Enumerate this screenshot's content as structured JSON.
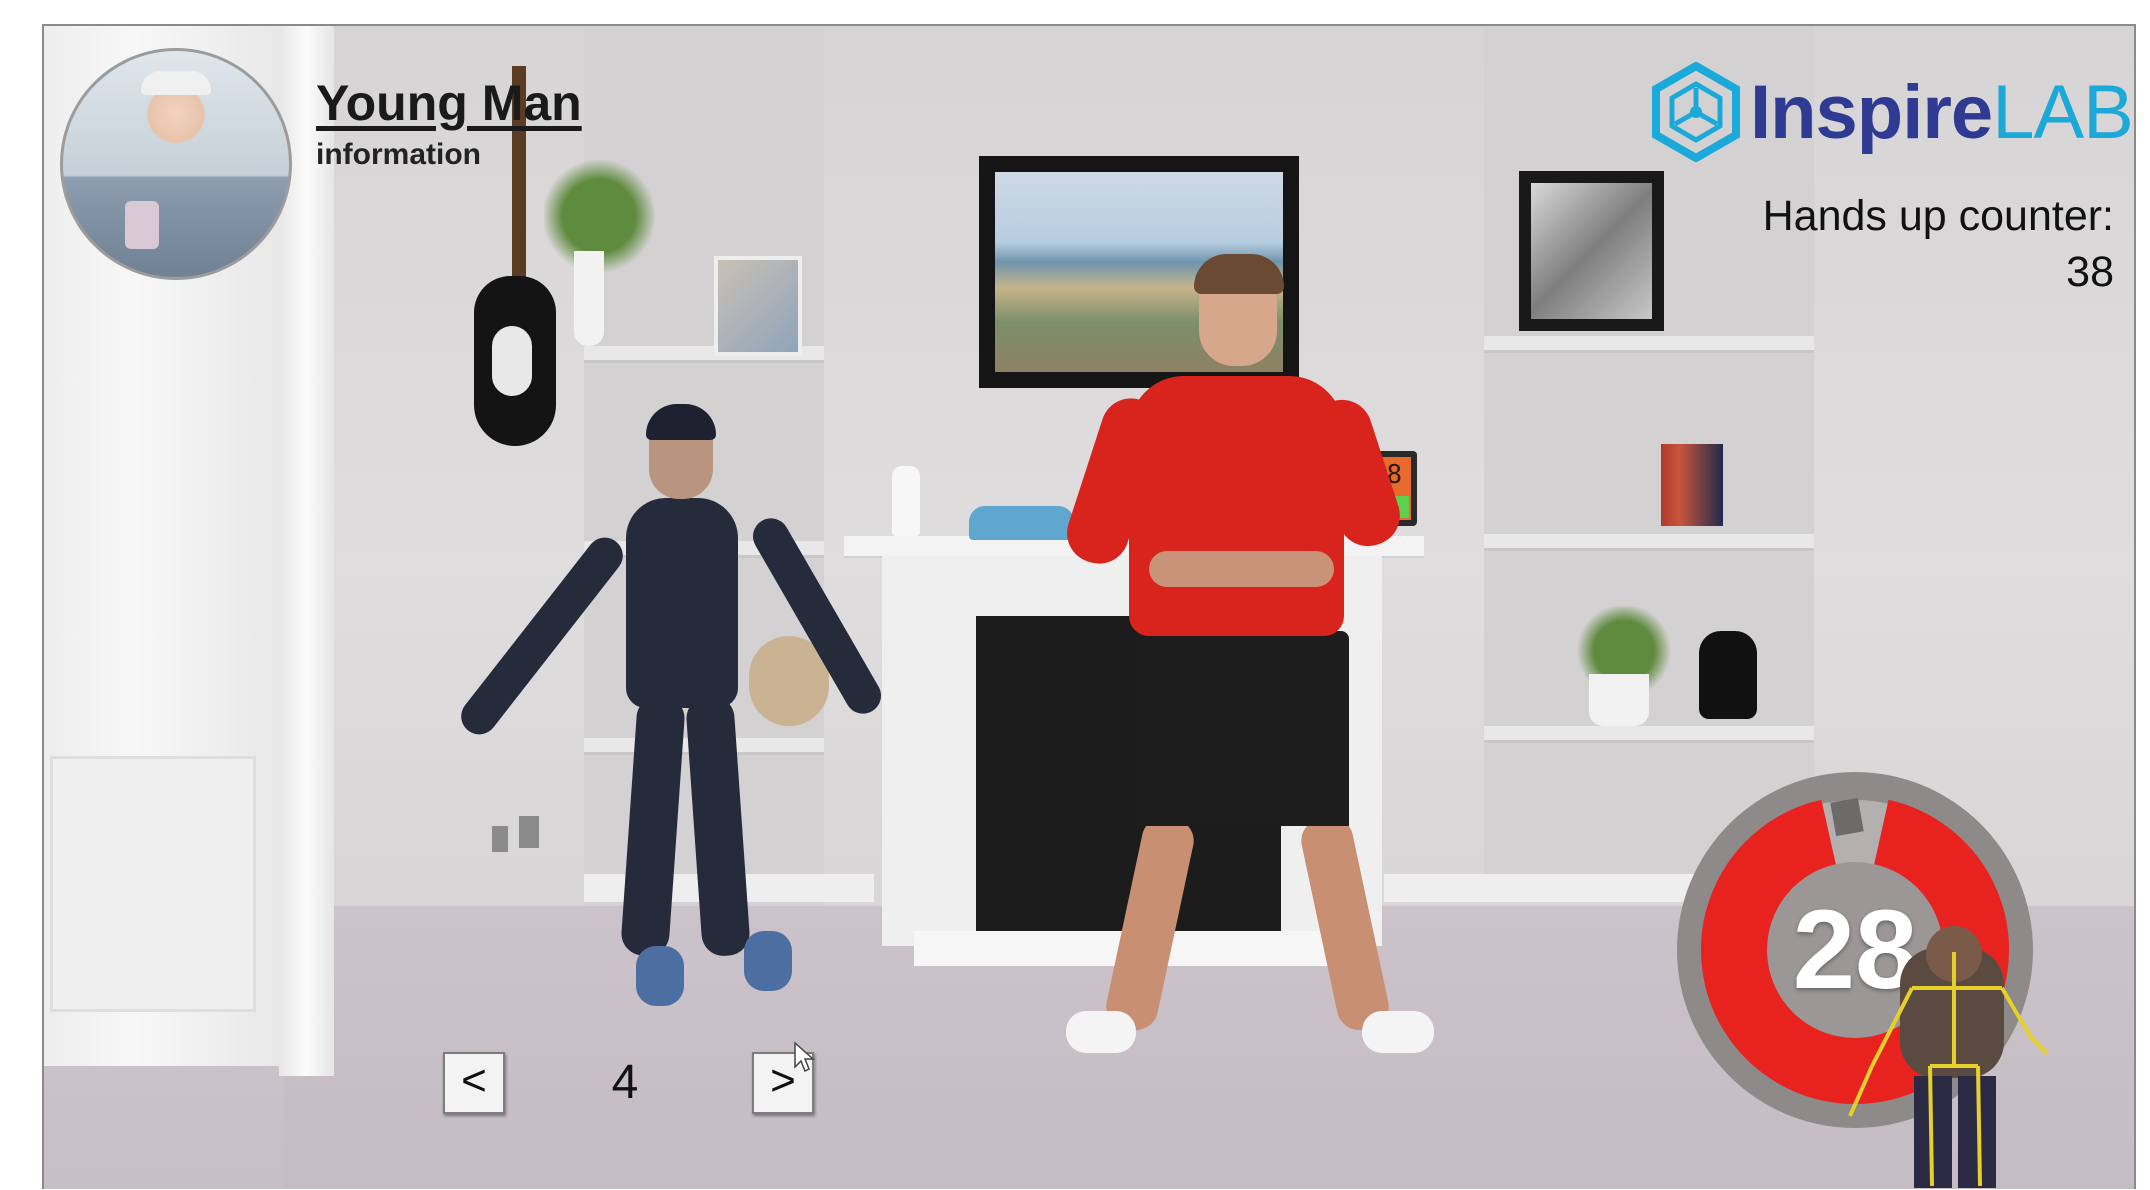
{
  "profile": {
    "name": "Young Man",
    "subtitle": "information"
  },
  "brand": {
    "name_bold": "Inspire",
    "name_light": "LAB",
    "primary_color": "#2f3a93",
    "accent_color": "#1aa9d9"
  },
  "counter": {
    "label": "Hands up counter:",
    "value": "38"
  },
  "scene_clock": {
    "display": "00:28"
  },
  "navigation": {
    "prev_label": "<",
    "next_label": ">",
    "index": "4"
  },
  "timer": {
    "value": 28,
    "label": "28",
    "ring_color": "#e8231f",
    "ring_background": "#8e8a8a",
    "remaining_fraction": 0.93
  }
}
